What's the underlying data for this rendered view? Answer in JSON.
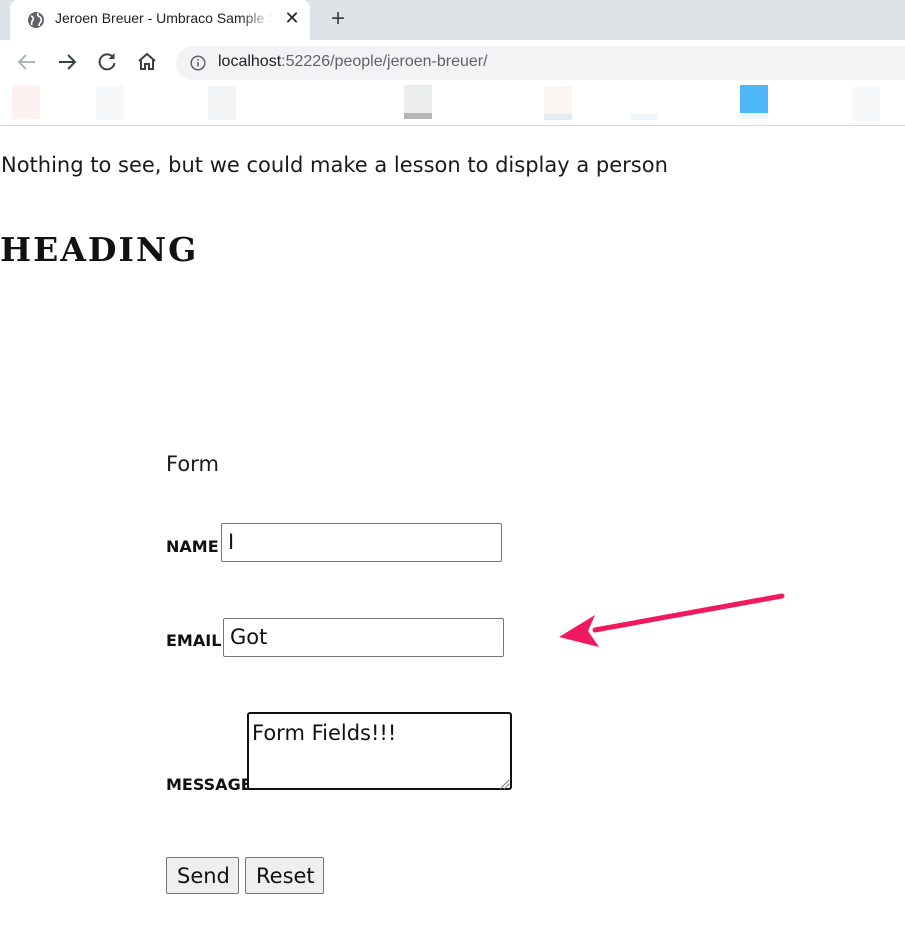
{
  "browser": {
    "tab_title": "Jeroen Breuer - Umbraco Sample Site",
    "close_glyph": "✕",
    "new_tab_glyph": "+",
    "url_host": "localhost",
    "url_path": ":52226/people/jeroen-breuer/"
  },
  "page": {
    "intro": "Nothing to see, but we could make a lesson to display a person",
    "heading": "HEADING"
  },
  "form": {
    "title": "Form",
    "name_label": "NAME",
    "name_value": "I",
    "email_label": "EMAIL",
    "email_value": "Got",
    "message_label": "MESSAGE",
    "message_value": "Form Fields!!!",
    "send_label": "Send",
    "reset_label": "Reset"
  },
  "colors": {
    "annotation_arrow": "#f0195e",
    "tabstrip": "#dee1e6",
    "omnibox": "#f1f3f4"
  },
  "icons": [
    "globe-icon",
    "close-icon",
    "plus-icon",
    "back-icon",
    "forward-icon",
    "reload-icon",
    "home-icon",
    "info-icon",
    "resize-grip-icon",
    "arrow-annotation"
  ]
}
